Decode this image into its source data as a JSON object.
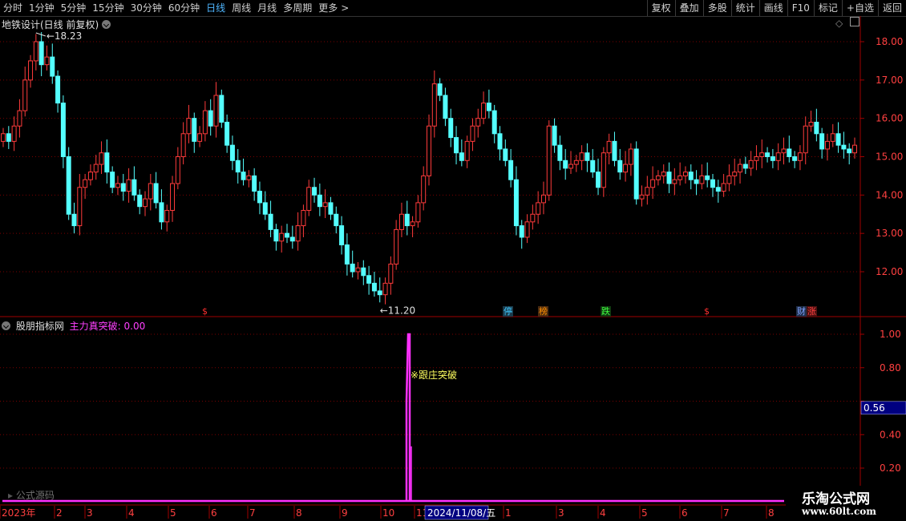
{
  "toolbar": {
    "periods": [
      "分时",
      "1分钟",
      "5分钟",
      "15分钟",
      "30分钟",
      "60分钟",
      "日线",
      "周线",
      "月线",
      "多周期",
      "更多"
    ],
    "more_arrow": ">",
    "active_period": "日线",
    "actions": [
      "复权",
      "叠加",
      "多股",
      "统计",
      "画线",
      "F10",
      "标记",
      "+自选",
      "返回"
    ]
  },
  "main_chart": {
    "title": "地铁设计(日线 前复权)",
    "high_label": "18.23",
    "low_label": "11.20",
    "price_ticks": [
      "18.00",
      "17.00",
      "16.00",
      "15.00",
      "14.00",
      "13.00",
      "12.00"
    ],
    "markers": [
      {
        "text": "$",
        "color": "#ff3030",
        "bg": ""
      },
      {
        "text": "停",
        "color": "#40c8ff",
        "bg": "#1a3a4a"
      },
      {
        "text": "榜",
        "color": "#ff9000",
        "bg": "#4a2a10"
      },
      {
        "text": "跌",
        "color": "#40ff40",
        "bg": "#103a10"
      },
      {
        "text": "$",
        "color": "#ff3030",
        "bg": ""
      },
      {
        "text": "财",
        "color": "#80a0ff",
        "bg": "#20304a"
      },
      {
        "text": "涨",
        "color": "#ff4040",
        "bg": "#4a1010"
      }
    ],
    "colors": {
      "up": "#ff3b3b",
      "down": "#54ffff",
      "axis": "#a00000",
      "grid": "#7a0000"
    }
  },
  "indicator": {
    "panel_name": "股朋指标网",
    "series_label": "主力真突破: 0.00",
    "annotation": "※跟庄突破",
    "value_ticks": [
      "1.00",
      "0.80",
      "0.40",
      "0.20"
    ],
    "current_value": "0.56",
    "formula_link": "公式源码",
    "colors": {
      "line": "#ff30ff",
      "annotation": "#ffff60"
    }
  },
  "time_axis": {
    "labels": [
      "2023年",
      "2",
      "3",
      "4",
      "5",
      "6",
      "7",
      "8",
      "9",
      "10",
      "11",
      "1",
      "3",
      "4",
      "5",
      "6",
      "7",
      "8"
    ],
    "cursor_date": "2024/11/08/五"
  },
  "chart_data": {
    "type": "candlestick",
    "title": "地铁设计(日线 前复权)",
    "ylim": [
      11.0,
      18.3
    ],
    "high": 18.23,
    "low": 11.2,
    "close_series": [
      15.6,
      15.4,
      15.8,
      16.2,
      17.0,
      17.5,
      18.0,
      17.4,
      17.6,
      17.1,
      16.4,
      15.0,
      13.5,
      13.2,
      14.2,
      14.4,
      14.6,
      14.8,
      15.1,
      14.6,
      14.2,
      14.3,
      14.1,
      14.4,
      14.0,
      13.7,
      13.9,
      14.3,
      13.8,
      13.3,
      13.6,
      14.3,
      15.0,
      15.6,
      16.0,
      15.4,
      15.6,
      16.2,
      15.8,
      16.6,
      15.9,
      15.3,
      14.9,
      14.6,
      14.4,
      14.5,
      14.1,
      13.8,
      13.5,
      13.1,
      12.8,
      13.0,
      12.9,
      12.8,
      13.2,
      13.6,
      14.2,
      14.0,
      13.7,
      13.8,
      13.5,
      13.2,
      12.7,
      12.2,
      12.0,
      12.1,
      11.9,
      11.7,
      11.5,
      11.4,
      11.7,
      12.2,
      13.1,
      13.5,
      13.2,
      13.3,
      13.8,
      14.5,
      15.8,
      16.9,
      16.6,
      16.0,
      15.5,
      15.1,
      14.9,
      15.4,
      15.8,
      16.0,
      16.4,
      16.2,
      15.6,
      15.2,
      14.9,
      14.4,
      13.2,
      12.9,
      13.3,
      13.5,
      13.8,
      14.0,
      15.8,
      15.3,
      14.9,
      14.7,
      14.8,
      14.9,
      15.1,
      14.9,
      14.6,
      14.2,
      15.1,
      15.4,
      14.9,
      14.6,
      14.8,
      15.2,
      13.9,
      14.0,
      14.2,
      14.4,
      14.5,
      14.6,
      14.3,
      14.4,
      14.5,
      14.6,
      14.4,
      14.3,
      14.5,
      14.4,
      14.2,
      14.1,
      14.3,
      14.5,
      14.6,
      14.8,
      14.7,
      14.9,
      15.0,
      15.1,
      15.0,
      14.9,
      15.1,
      15.2,
      15.0,
      14.9,
      15.1,
      15.8,
      15.9,
      15.6,
      15.2,
      15.4,
      15.6,
      15.3,
      15.2,
      15.1,
      15.3
    ]
  }
}
